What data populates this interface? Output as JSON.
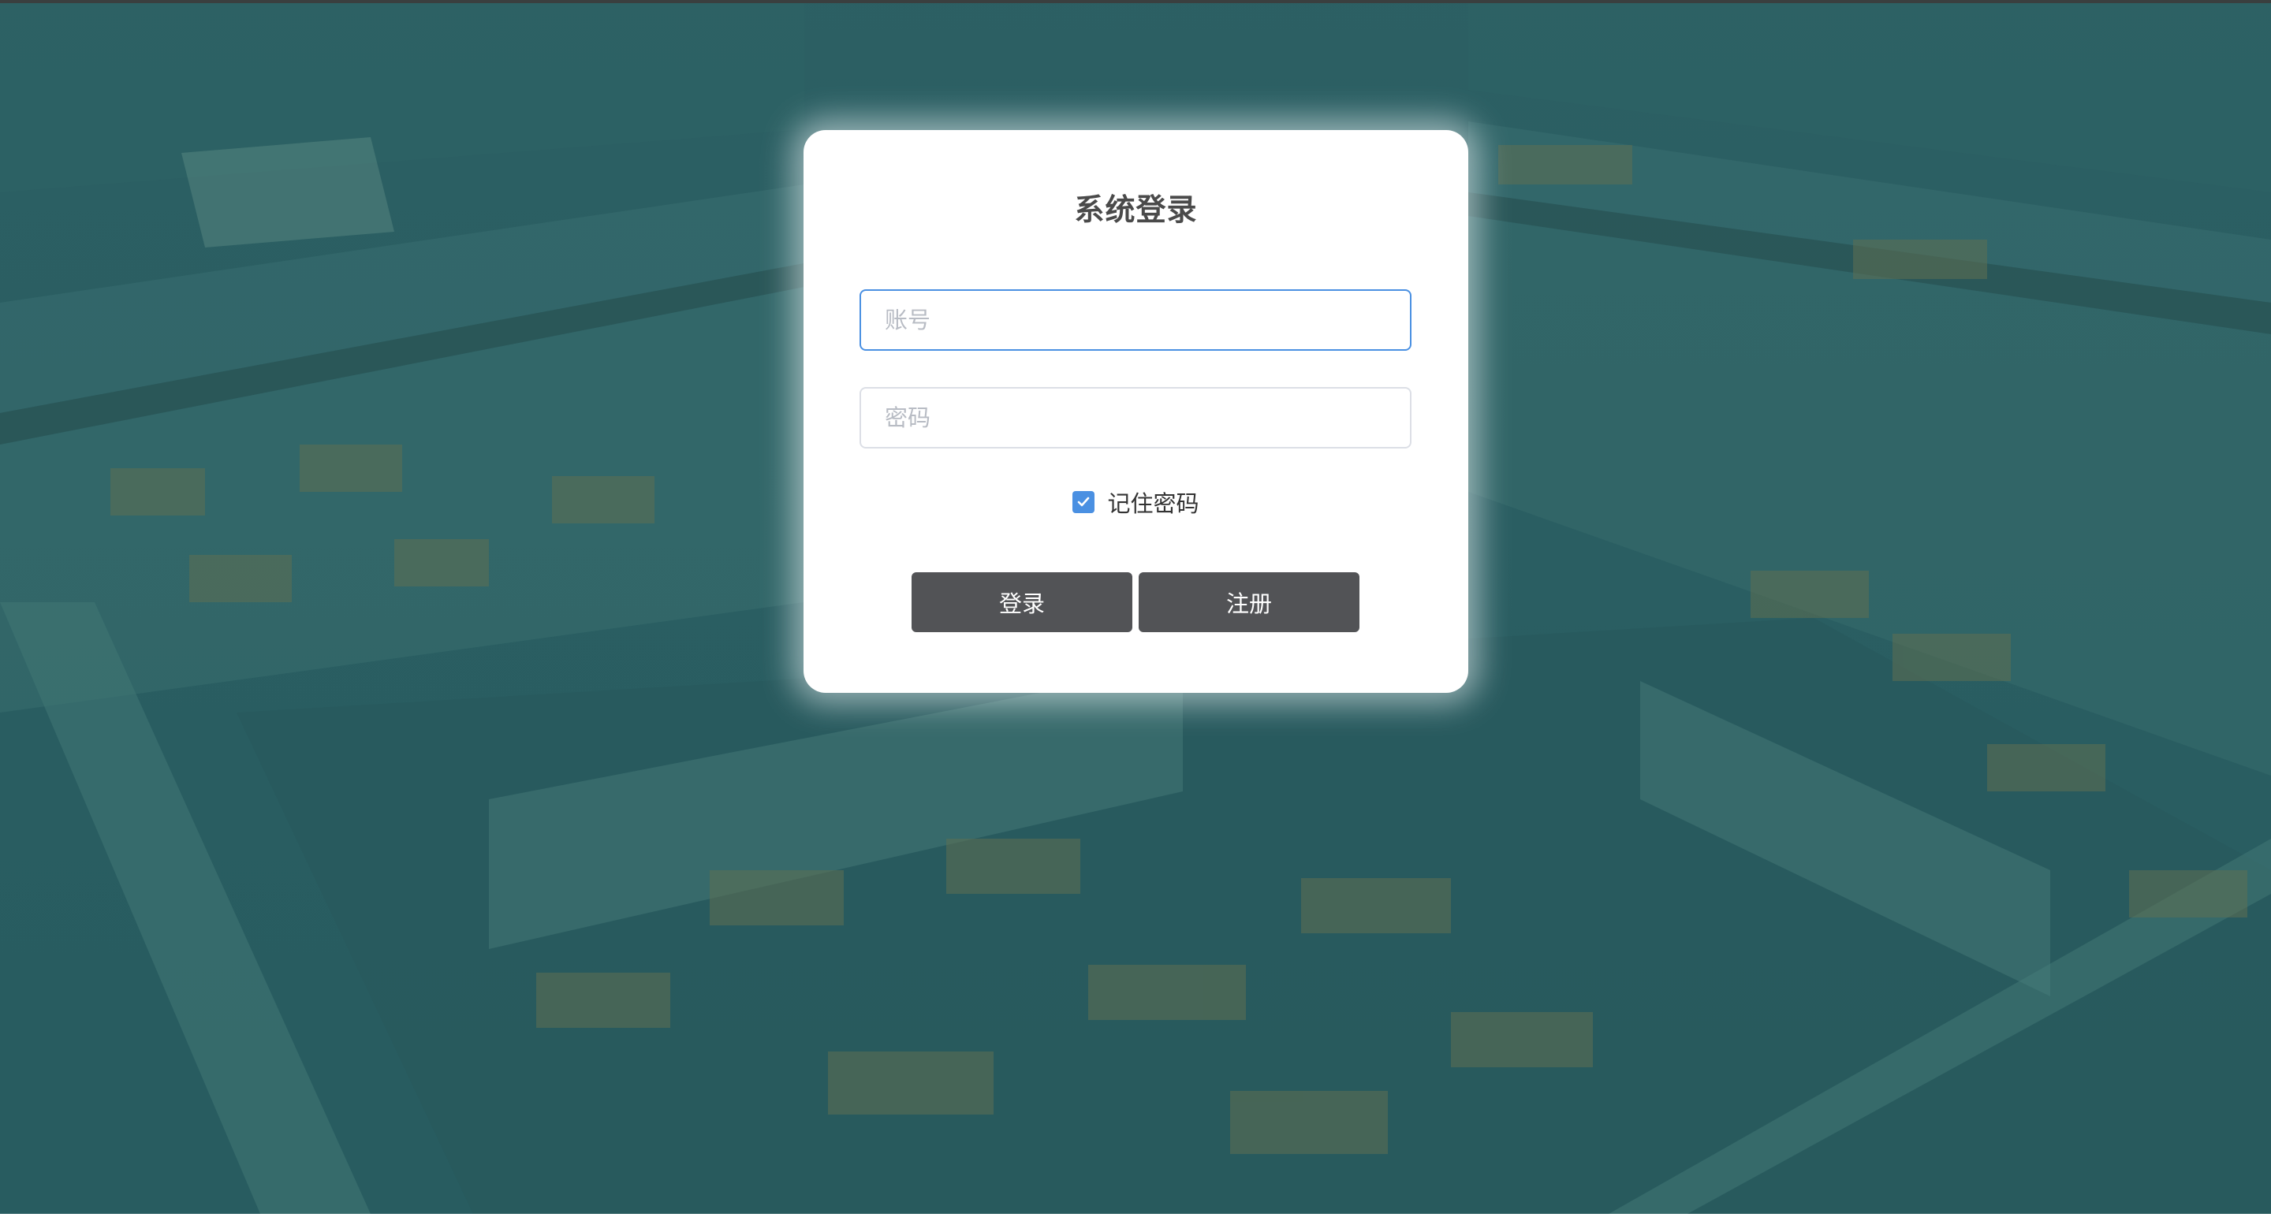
{
  "login": {
    "title": "系统登录",
    "account_placeholder": "账号",
    "password_placeholder": "密码",
    "remember_label": "记住密码",
    "remember_checked": true,
    "login_button": "登录",
    "register_button": "注册"
  },
  "colors": {
    "background_tint": "#2a5f63",
    "button": "#525356",
    "checkbox": "#4a90e2",
    "focus_border": "#4a90e2"
  }
}
